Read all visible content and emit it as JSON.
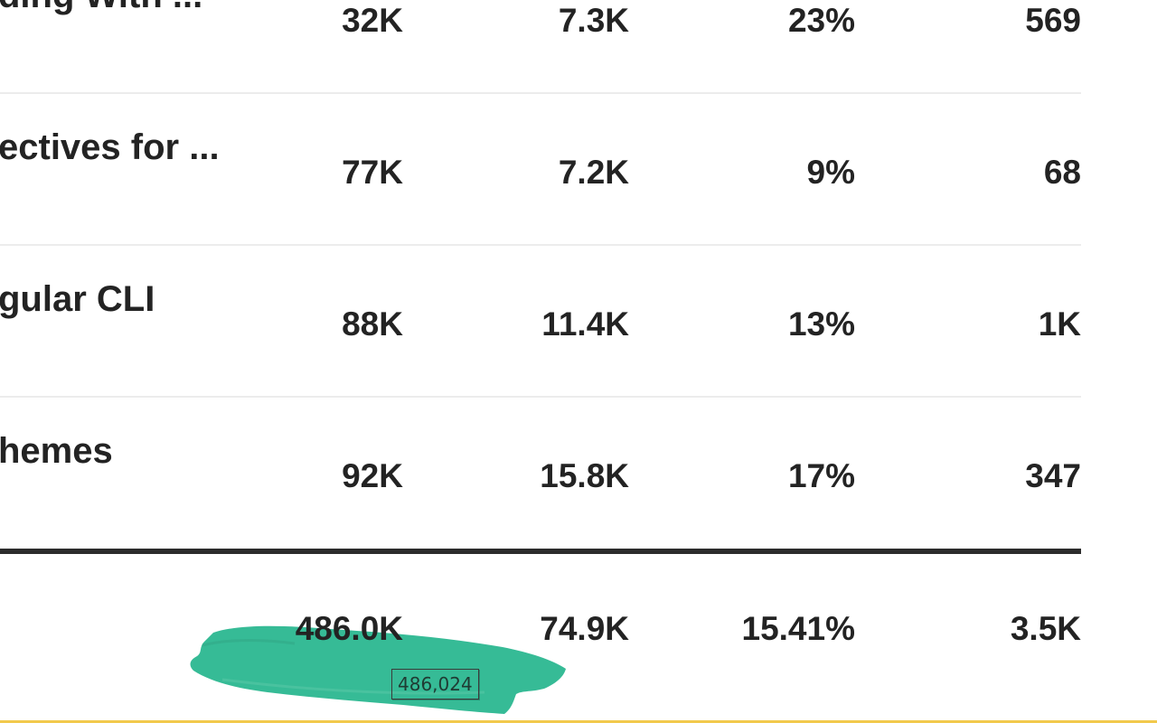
{
  "table": {
    "rows": [
      {
        "title": "ding With ...",
        "col1": "32K",
        "col2": "7.3K",
        "col3": "23%",
        "col4": "569"
      },
      {
        "title": "ectives for ...",
        "col1": "77K",
        "col2": "7.2K",
        "col3": "9%",
        "col4": "68"
      },
      {
        "title": "gular CLI",
        "col1": "88K",
        "col2": "11.4K",
        "col3": "13%",
        "col4": "1K"
      },
      {
        "title": "hemes",
        "col1": "92K",
        "col2": "15.8K",
        "col3": "17%",
        "col4": "347"
      }
    ],
    "totals": {
      "col1": "486.0K",
      "col2": "74.9K",
      "col3": "15.41%",
      "col4": "3.5K"
    }
  },
  "tooltip": {
    "text": "486,024"
  },
  "colors": {
    "highlight": "#36bb96",
    "divider": "#2c2c2c",
    "row_border": "#ececec",
    "bottom_accent": "#f2c94c",
    "text": "#232323"
  }
}
